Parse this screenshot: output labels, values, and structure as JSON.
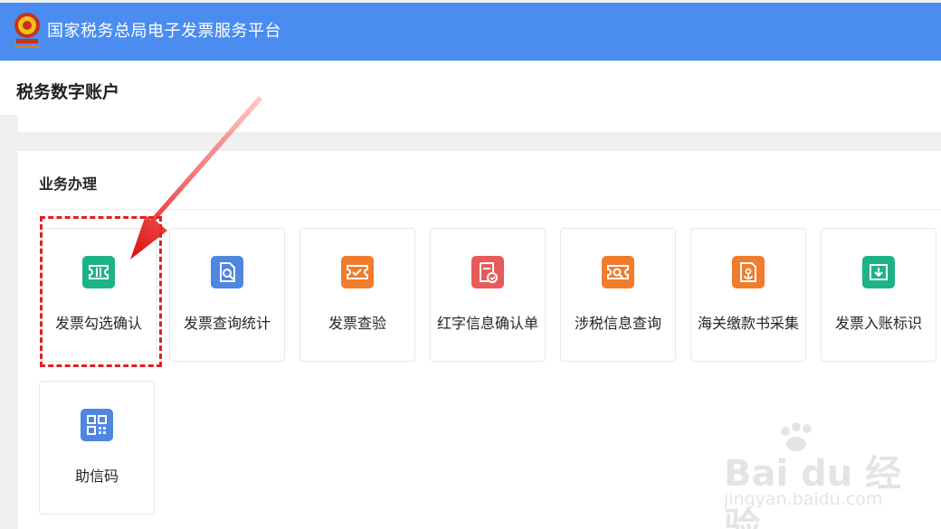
{
  "header": {
    "app_title": "国家税务总局电子发票服务平台",
    "logo_icon": "tax-emblem-icon"
  },
  "page": {
    "title": "税务数字账户"
  },
  "business": {
    "section_title": "业务办理",
    "tiles": [
      {
        "label": "发票勾选确认",
        "icon": "ticket-icon",
        "color": "#1db389"
      },
      {
        "label": "发票查询统计",
        "icon": "search-document-icon",
        "color": "#4f86e0"
      },
      {
        "label": "发票查验",
        "icon": "ticket-verify-icon",
        "color": "#f07c2c"
      },
      {
        "label": "红字信息确认单",
        "icon": "document-check-icon",
        "color": "#e85b5b"
      },
      {
        "label": "涉税信息查询",
        "icon": "ticket-search-icon",
        "color": "#f07c2c"
      },
      {
        "label": "海关缴款书采集",
        "icon": "customs-document-icon",
        "color": "#f07c2c"
      },
      {
        "label": "发票入账标识",
        "icon": "inbox-download-icon",
        "color": "#1db389"
      },
      {
        "label": "助信码",
        "icon": "qrcode-icon",
        "color": "#4f86e0"
      }
    ]
  },
  "watermark": {
    "brand": "Bai du 经验",
    "url": "jingyan.baidu.com"
  },
  "annotation": {
    "color": "#e02020"
  }
}
